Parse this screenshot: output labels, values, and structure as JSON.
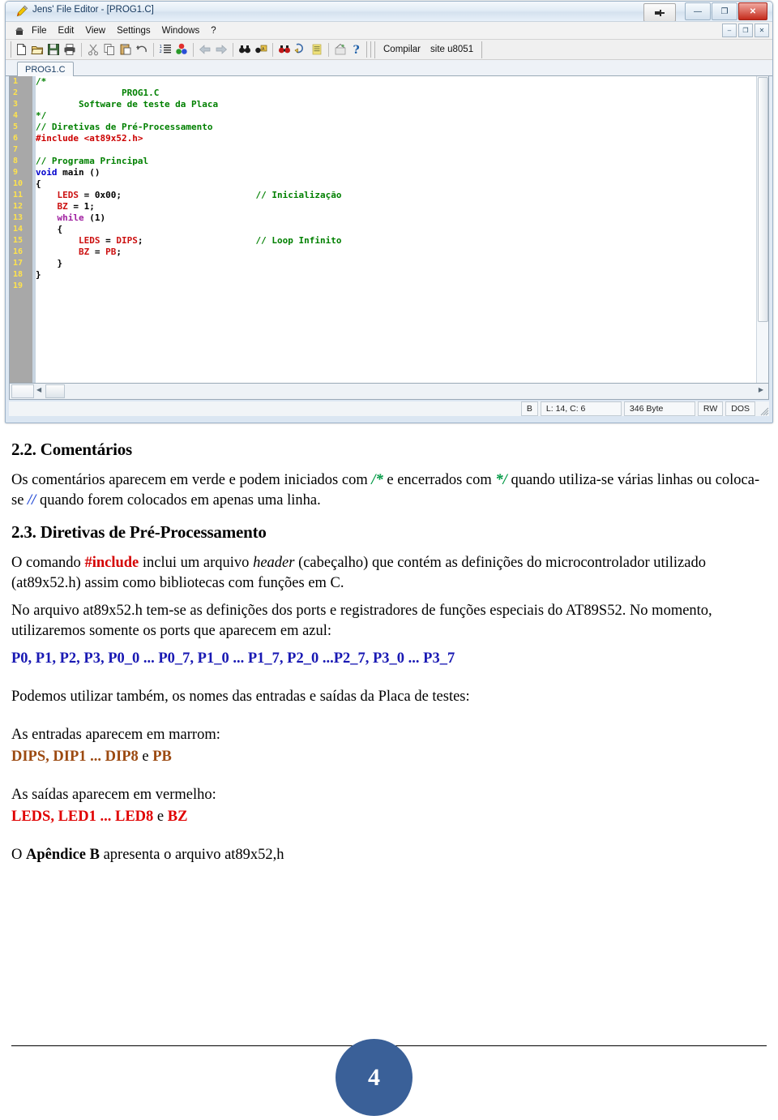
{
  "app": {
    "title": "Jens' File Editor - [PROG1.C]",
    "title_icon": "pencil-icon",
    "window_buttons": {
      "minimize": "—",
      "maximize": "❐",
      "close": "✕"
    },
    "pin_button": "pin-icon",
    "mdi_buttons": {
      "minimize": "–",
      "restore": "❐",
      "close": "✕"
    },
    "menu": [
      "File",
      "Edit",
      "View",
      "Settings",
      "Windows",
      "?"
    ],
    "toolbar_icons": [
      "new-file-icon",
      "open-folder-icon",
      "save-icon",
      "print-icon",
      "cut-icon",
      "copy-icon",
      "paste-icon",
      "undo-icon",
      "line-numbers-icon",
      "colors-icon",
      "back-arrow-icon",
      "forward-arrow-icon",
      "find-icon",
      "find-next-icon",
      "find-all-icon",
      "goto-icon",
      "highlight-icon",
      "bookmark-icon",
      "help-icon"
    ],
    "compile_label": "Compilar",
    "site_label": "site u8051",
    "document_tab": "PROG1.C",
    "status": {
      "mode": "B",
      "cursor": "L: 14, C: 6",
      "size": "346 Byte",
      "access": "RW",
      "format": "DOS"
    }
  },
  "code": {
    "lines": [
      {
        "n": "1",
        "tokens": [
          {
            "t": "/*",
            "c": "c-cmt"
          }
        ]
      },
      {
        "n": "2",
        "tokens": [
          {
            "t": "                PROG1.C",
            "c": "c-cmt"
          }
        ]
      },
      {
        "n": "3",
        "tokens": [
          {
            "t": "        Software de teste da Placa",
            "c": "c-cmt"
          }
        ]
      },
      {
        "n": "4",
        "tokens": [
          {
            "t": "*/",
            "c": "c-cmt"
          }
        ]
      },
      {
        "n": "5",
        "tokens": [
          {
            "t": "// Diretivas de Pré-Processamento",
            "c": "c-cmt"
          }
        ]
      },
      {
        "n": "6",
        "tokens": [
          {
            "t": "#include <at89x52.h>",
            "c": "c-pre"
          }
        ]
      },
      {
        "n": "7",
        "tokens": [
          {
            "t": "",
            "c": "c-pl"
          }
        ]
      },
      {
        "n": "8",
        "tokens": [
          {
            "t": "// Programa Principal",
            "c": "c-cmt"
          }
        ]
      },
      {
        "n": "9",
        "tokens": [
          {
            "t": "void",
            "c": "c-kw"
          },
          {
            "t": " main ()",
            "c": "c-pl"
          }
        ]
      },
      {
        "n": "10",
        "tokens": [
          {
            "t": "{",
            "c": "c-pl"
          }
        ]
      },
      {
        "n": "11",
        "tokens": [
          {
            "t": "    ",
            "c": "c-pl"
          },
          {
            "t": "LEDS",
            "c": "c-id"
          },
          {
            "t": " = 0x00;",
            "c": "c-pl"
          },
          {
            "t": "                         // Inicialização",
            "c": "c-cmt"
          }
        ]
      },
      {
        "n": "12",
        "tokens": [
          {
            "t": "    ",
            "c": "c-pl"
          },
          {
            "t": "BZ",
            "c": "c-id"
          },
          {
            "t": " = 1;",
            "c": "c-pl"
          }
        ]
      },
      {
        "n": "13",
        "tokens": [
          {
            "t": "    ",
            "c": "c-pl"
          },
          {
            "t": "while",
            "c": "c-ctl"
          },
          {
            "t": " (1)",
            "c": "c-pl"
          }
        ]
      },
      {
        "n": "14",
        "tokens": [
          {
            "t": "    {",
            "c": "c-pl"
          }
        ]
      },
      {
        "n": "15",
        "tokens": [
          {
            "t": "        ",
            "c": "c-pl"
          },
          {
            "t": "LEDS",
            "c": "c-id"
          },
          {
            "t": " = ",
            "c": "c-pl"
          },
          {
            "t": "DIPS",
            "c": "c-id"
          },
          {
            "t": ";",
            "c": "c-pl"
          },
          {
            "t": "                     // Loop Infinito",
            "c": "c-cmt"
          }
        ]
      },
      {
        "n": "16",
        "tokens": [
          {
            "t": "        ",
            "c": "c-pl"
          },
          {
            "t": "BZ",
            "c": "c-id"
          },
          {
            "t": " = ",
            "c": "c-pl"
          },
          {
            "t": "PB",
            "c": "c-id"
          },
          {
            "t": ";",
            "c": "c-pl"
          }
        ]
      },
      {
        "n": "17",
        "tokens": [
          {
            "t": "    }",
            "c": "c-pl"
          }
        ]
      },
      {
        "n": "18",
        "tokens": [
          {
            "t": "}",
            "c": "c-pl"
          }
        ]
      },
      {
        "n": "19",
        "tokens": [
          {
            "t": "",
            "c": "c-pl"
          }
        ]
      }
    ]
  },
  "document": {
    "section_22_heading": "2.2. Comentários",
    "para_comments": {
      "t1": "Os comentários aparecem em verde e podem iniciados com ",
      "g1": "/*",
      "t2": " e encerrados com ",
      "g2": "*/",
      "t3": " quando utiliza-se várias linhas ou coloca-se ",
      "b1": "//",
      "t4": " quando forem colocados em apenas uma linha."
    },
    "section_23_heading": "2.3. Diretivas de Pré-Processamento",
    "para_include": {
      "t1": "O comando ",
      "r1": "#include",
      "t2": " inclui um arquivo ",
      "i1": "header",
      "t3": " (cabeçalho) que contém as definições do microcontrolador utilizado (at89x52.h) assim como bibliotecas com funções em C."
    },
    "para_ports": "No arquivo at89x52.h tem-se as definições dos ports e registradores de funções especiais do AT89S52. No momento, utilizaremos somente os ports que aparecem em azul:",
    "ports_list": "P0,  P1,  P2,  P3,   P0_0 ... P0_7,   P1_0 ... P1_7,   P2_0 ...P2_7,   P3_0 ... P3_7",
    "para_names": "Podemos utilizar também, os nomes das entradas e saídas da Placa de testes:",
    "inputs_label": "As entradas aparecem em marrom:",
    "inputs_line": {
      "a": "DIPS,  DIP1 ... DIP8",
      "mid": " e ",
      "b": "PB"
    },
    "outputs_label": "As saídas aparecem em vermelho:",
    "outputs_line": {
      "a": "LEDS, LED1 ... LED8",
      "mid": " e ",
      "b": "BZ"
    },
    "appendix": {
      "t1": "O ",
      "b1": "Apêndice B",
      "t2": " apresenta o arquivo at89x52,h"
    },
    "page_number": "4"
  },
  "colors": {
    "comment_green": "#008000",
    "preproc_red": "#cc0000",
    "keyword_blue": "#0000cc",
    "control_purple": "#a020a0",
    "identifier_red": "#cc1111",
    "gutter_gray": "#a8a8a8",
    "line_number_yellow": "#ffe34d",
    "doc_blue": "#1919b3",
    "doc_brown": "#9c4a11",
    "doc_red": "#e00000",
    "page_circle_blue": "#3a6098"
  }
}
